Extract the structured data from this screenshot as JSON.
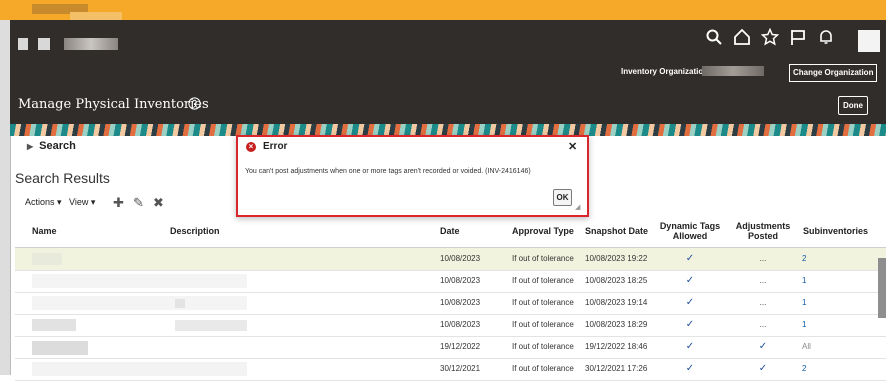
{
  "header": {
    "org_label": "Inventory Organizatio",
    "change_org_label": "Change Organization",
    "page_title": "Manage Physical Inventories",
    "done_label": "Done"
  },
  "search": {
    "label": "Search"
  },
  "results": {
    "title": "Search Results",
    "actions_label": "Actions ▾",
    "view_label": "View ▾"
  },
  "table": {
    "columns": {
      "name": "Name",
      "description": "Description",
      "date": "Date",
      "approval": "Approval Type",
      "snapshot": "Snapshot Date",
      "dynamic": "Dynamic Tags Allowed",
      "adjustments": "Adjustments Posted",
      "subinventories": "Subinventories"
    },
    "rows": [
      {
        "date": "10/08/2023",
        "approval": "If out of tolerance",
        "snapshot": "10/08/2023 19:22",
        "dynamic": "✓",
        "adjustments": "...",
        "subinventories": "2"
      },
      {
        "date": "10/08/2023",
        "approval": "If out of tolerance",
        "snapshot": "10/08/2023 18:25",
        "dynamic": "✓",
        "adjustments": "...",
        "subinventories": "1"
      },
      {
        "date": "10/08/2023",
        "approval": "If out of tolerance",
        "snapshot": "10/08/2023 19:14",
        "dynamic": "✓",
        "adjustments": "...",
        "subinventories": "1"
      },
      {
        "date": "10/08/2023",
        "approval": "If out of tolerance",
        "snapshot": "10/08/2023 18:29",
        "dynamic": "✓",
        "adjustments": "...",
        "subinventories": "1"
      },
      {
        "date": "19/12/2022",
        "approval": "If out of tolerance",
        "snapshot": "19/12/2022 18:46",
        "dynamic": "✓",
        "adjustments": "✓",
        "subinventories": "All"
      },
      {
        "date": "30/12/2021",
        "approval": "If out of tolerance",
        "snapshot": "30/12/2021 17:26",
        "dynamic": "✓",
        "adjustments": "✓",
        "subinventories": "2"
      }
    ]
  },
  "dialog": {
    "title": "Error",
    "message": "You can't post adjustments when one or more tags aren't recorded or voided. (INV-2416146)",
    "ok_label": "OK"
  },
  "colors": {
    "accent_bar": "#f6a828",
    "header_bg": "#312d2a",
    "error_border": "#d9262c",
    "link": "#0d5ba8"
  }
}
